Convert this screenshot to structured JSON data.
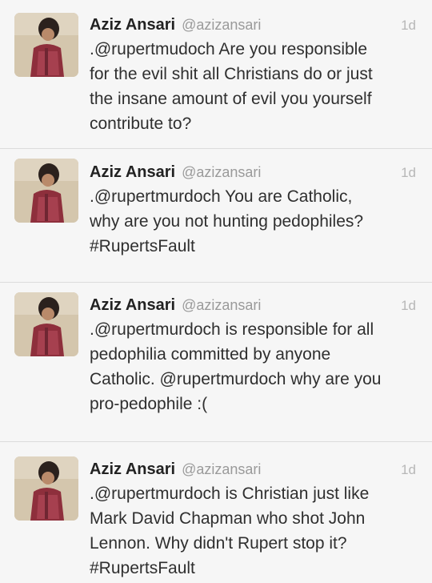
{
  "tweets": [
    {
      "author_name": "Aziz Ansari",
      "author_handle": "@azizansari",
      "time": "1d",
      "text": ".@rupertmudoch Are you responsible\nfor the evil shit all Christians do or just\nthe insane amount of evil you yourself\ncontribute to?"
    },
    {
      "author_name": "Aziz Ansari",
      "author_handle": "@azizansari",
      "time": "1d",
      "text": ".@rupertmurdoch You are Catholic,\nwhy are you not hunting pedophiles?\n#RupertsFault"
    },
    {
      "author_name": "Aziz Ansari",
      "author_handle": "@azizansari",
      "time": "1d",
      "text": ".@rupertmurdoch is responsible for all\npedophilia committed by anyone\nCatholic. @rupertmurdoch why are you\npro-pedophile :("
    },
    {
      "author_name": "Aziz Ansari",
      "author_handle": "@azizansari",
      "time": "1d",
      "text": ".@rupertmurdoch is Christian just like\nMark David Chapman who shot John\nLennon. Why didn't Rupert stop it?\n#RupertsFault"
    }
  ]
}
